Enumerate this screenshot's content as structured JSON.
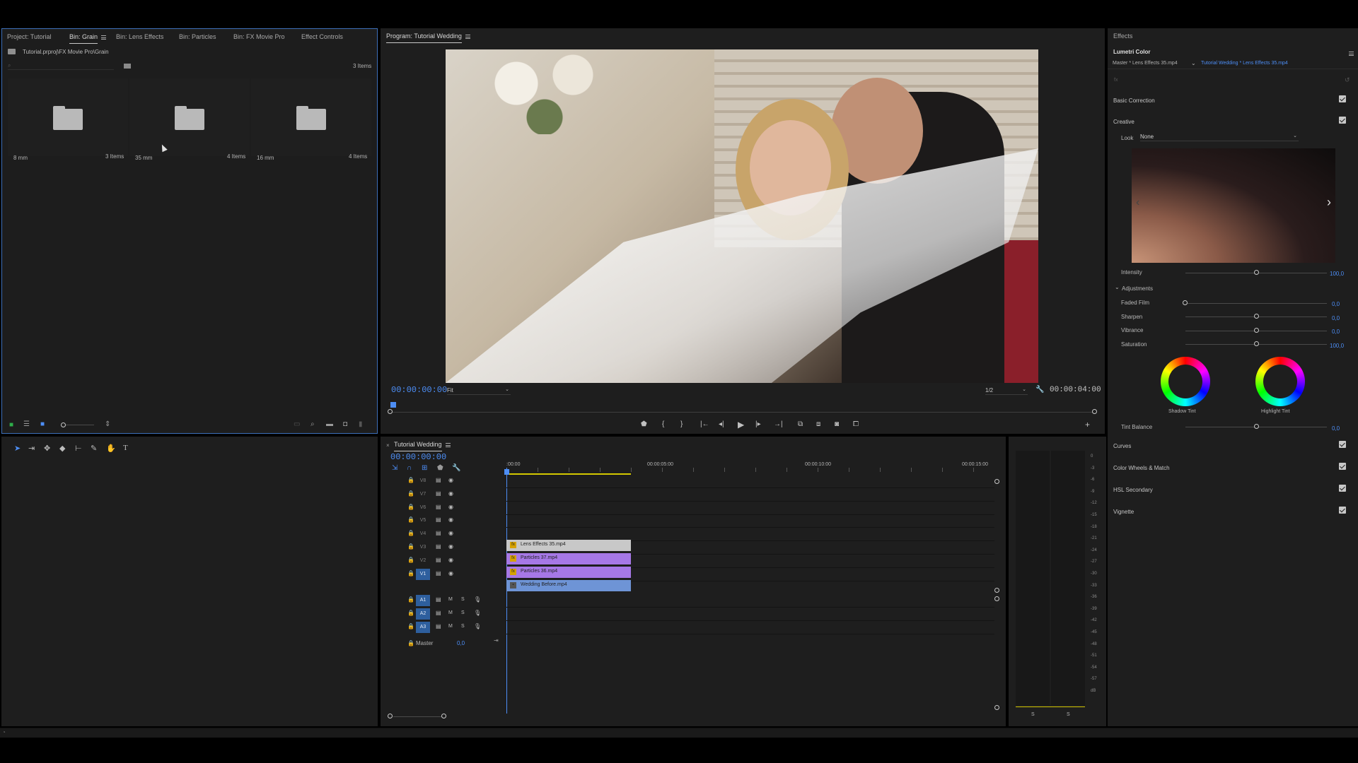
{
  "project_panel": {
    "tabs": [
      "Project: Tutorial",
      "Bin: Grain",
      "Bin: Lens Effects",
      "Bin: Particles",
      "Bin: FX Movie Pro",
      "Effect Controls"
    ],
    "path": "Tutorial.prproj\\FX Movie Pro\\Grain",
    "item_count": "3 Items",
    "folders": [
      {
        "name": "8 mm",
        "count": "3 Items"
      },
      {
        "name": "35 mm",
        "count": "4 Items"
      },
      {
        "name": "16 mm",
        "count": "4 Items"
      }
    ]
  },
  "program_monitor": {
    "title": "Program: Tutorial Wedding",
    "timecode": "00:00:00:00",
    "fit": "Fit",
    "resolution": "1/2",
    "duration": "00:00:04:00"
  },
  "timeline": {
    "title": "Tutorial Wedding",
    "timecode": "00:00:00:00",
    "ruler": [
      ":00:00",
      "00:00:05:00",
      "00:00:10:00",
      "00:00:15:00"
    ],
    "video_tracks": [
      "V8",
      "V7",
      "V6",
      "V5",
      "V4",
      "V3",
      "V2",
      "V1"
    ],
    "audio_tracks": [
      "A1",
      "A2",
      "A3"
    ],
    "master_label": "Master",
    "master_value": "0,0",
    "clips": [
      "Lens Effects 35.mp4",
      "Particles 37.mp4",
      "Particles 36.mp4",
      "Wedding Before.mp4"
    ],
    "audio_buttons": {
      "mute": "M",
      "solo": "S"
    }
  },
  "audio_meter": {
    "scale": [
      "0",
      "-3",
      "-6",
      "-9",
      "-12",
      "-15",
      "-18",
      "-21",
      "-24",
      "-27",
      "-30",
      "-33",
      "-36",
      "-39",
      "-42",
      "-45",
      "-48",
      "-51",
      "-54",
      "-57",
      "dB"
    ],
    "solo_labels": [
      "S",
      "S"
    ]
  },
  "effects_panel": {
    "title": "Effects",
    "subtitle": "Lumetri Color",
    "master_clip": "Master * Lens Effects 35.mp4",
    "sequence_clip": "Tutorial Wedding * Lens Effects 35.mp4",
    "basic_correction": "Basic Correction",
    "creative": "Creative",
    "look_label": "Look",
    "look_value": "None",
    "intensity_label": "Intensity",
    "intensity_value": "100,0",
    "adjustments": "Adjustments",
    "faded_film": {
      "label": "Faded Film",
      "value": "0,0"
    },
    "sharpen": {
      "label": "Sharpen",
      "value": "0,0"
    },
    "vibrance": {
      "label": "Vibrance",
      "value": "0,0"
    },
    "saturation": {
      "label": "Saturation",
      "value": "100,0"
    },
    "shadow_tint": "Shadow Tint",
    "highlight_tint": "Highlight Tint",
    "tint_balance": {
      "label": "Tint Balance",
      "value": "0,0"
    },
    "sections": [
      "Curves",
      "Color Wheels & Match",
      "HSL Secondary",
      "Vignette"
    ]
  },
  "colors": {
    "accent": "#4d8ef6",
    "panel": "#1e1e1e",
    "clip_purple": "#a678e6",
    "clip_blue": "#6e94d6"
  }
}
